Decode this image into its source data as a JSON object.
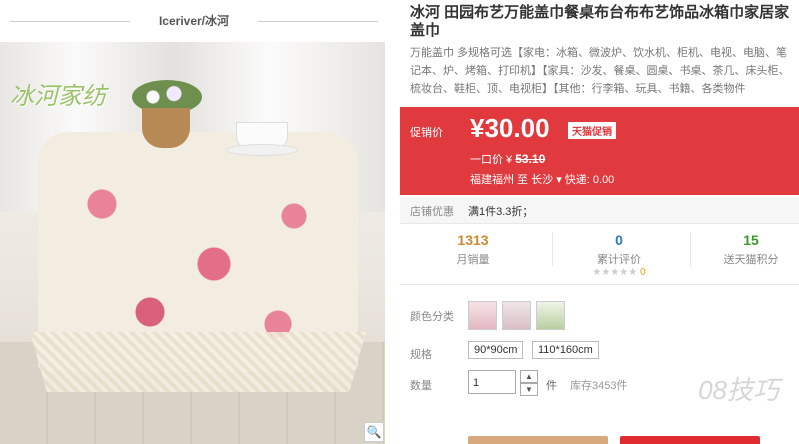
{
  "left": {
    "brand_header": "Iceriver/冰河",
    "logo_text": "冰河家纺",
    "zoom_icon": "magnifier-icon"
  },
  "product": {
    "title": "冰河 田园布艺万能盖巾餐桌布台布布艺饰品冰箱巾家居家盖巾",
    "subtitle": "万能盖巾 多规格可选【家电：冰箱、微波炉、饮水机、柜机、电视、电脑、笔记本、炉、烤箱、打印机】【家具：沙发、餐桌、圆桌、书桌、茶几、床头柜、梳妆台、鞋柜、顶、电视柜】【其他：行李箱、玩具、书籍、各类物件"
  },
  "price": {
    "label": "促销价",
    "value": "¥30.00",
    "badge": "天猫促销",
    "orig_label": "一口价 ¥",
    "orig_value": "53.10",
    "ship_from": "福建福州 至",
    "ship_to": "长沙",
    "ship_fee": "快递: 0.00"
  },
  "promo": {
    "label": "店铺优惠",
    "value": "满1件3.3折；"
  },
  "stats": {
    "sales_num": "1313",
    "sales_label": "月销量",
    "reviews_num": "0",
    "reviews_label": "累计评价",
    "reviews_stars_count": "0",
    "points_num": "15",
    "points_label": "送天猫积分"
  },
  "options": {
    "color_label": "颜色分类",
    "size_label": "规格",
    "sizes": [
      "90*90cm",
      "110*160cm"
    ],
    "qty_label": "数量",
    "qty_value": "1",
    "unit": "件",
    "stock": "库存3453件"
  },
  "watermark": "08技巧",
  "colors": {
    "accent": "#e0393e",
    "sales": "#c98a2f",
    "reviews": "#2f7ac4",
    "points": "#3a9a2c"
  }
}
